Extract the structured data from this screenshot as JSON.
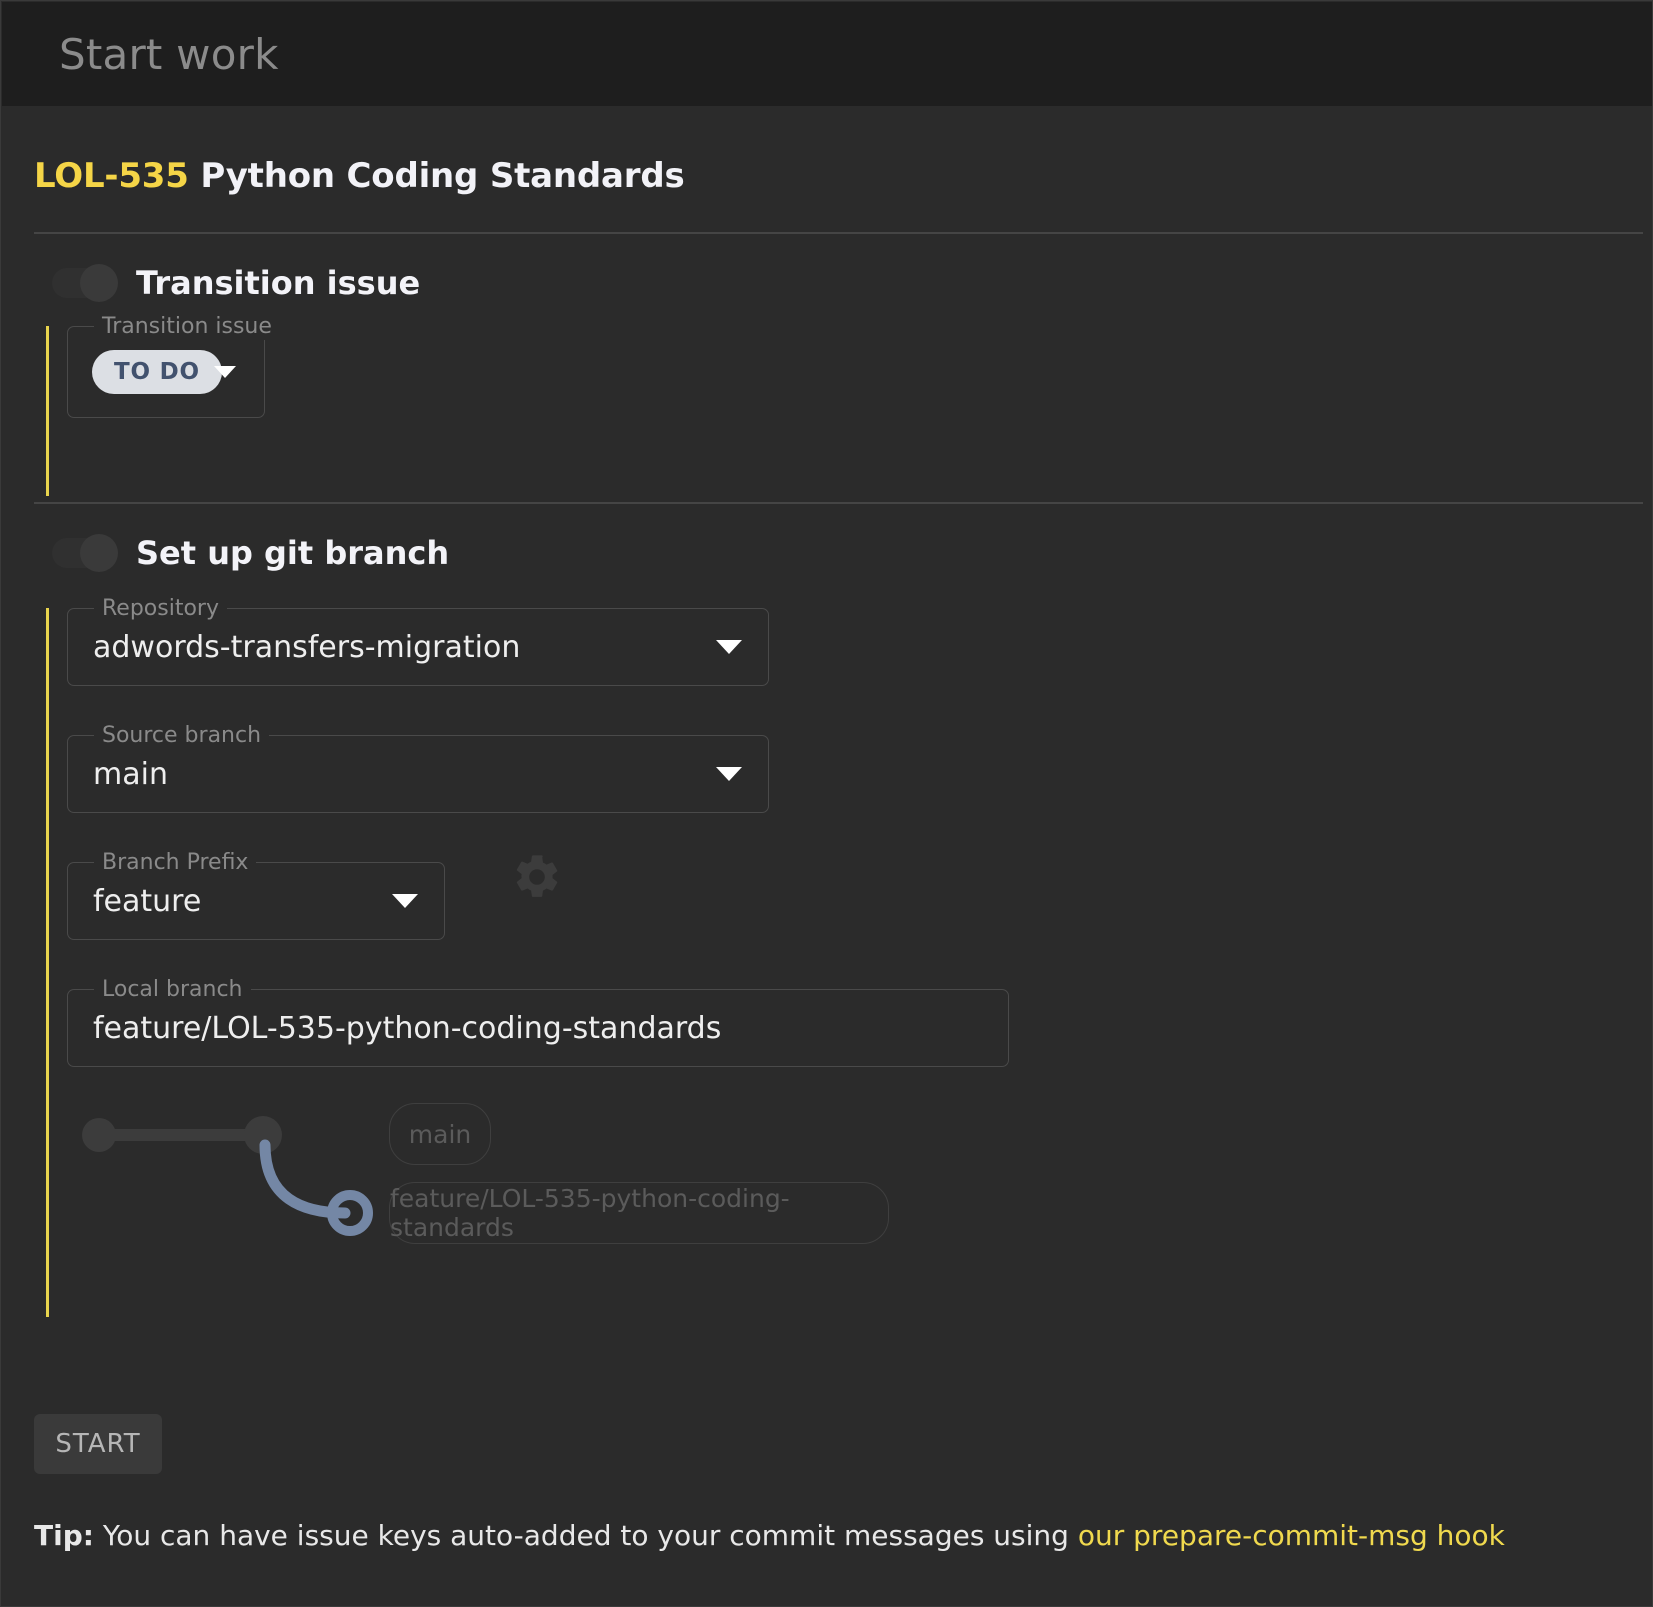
{
  "window": {
    "title": "Start work"
  },
  "issue": {
    "key": "LOL-535",
    "summary": "Python Coding Standards"
  },
  "transition_section": {
    "toggle_label": "Transition issue",
    "toggle_state": "on",
    "field": {
      "label": "Transition issue",
      "status_value": "TO DO"
    }
  },
  "git_section": {
    "toggle_label": "Set up git branch",
    "toggle_state": "on",
    "repository": {
      "label": "Repository",
      "value": "adwords-transfers-migration"
    },
    "source_branch": {
      "label": "Source branch",
      "value": "main"
    },
    "branch_prefix": {
      "label": "Branch Prefix",
      "value": "feature",
      "settings_icon": "gear-icon"
    },
    "local_branch": {
      "label": "Local branch",
      "value": "feature/LOL-535-python-coding-standards"
    },
    "graph": {
      "source_node_label": "main",
      "new_node_label": "feature/LOL-535-python-coding-standards"
    }
  },
  "footer": {
    "start_label": "START",
    "tip_prefix": "Tip:",
    "tip_text": "You can have issue keys auto-added to your commit messages using",
    "tip_link": "our prepare-commit-msg hook"
  },
  "colors": {
    "accent_yellow": "#e8d44d",
    "issue_key": "#f5d547",
    "link": "#f0d94e",
    "status_chip_bg": "#dcdfe4",
    "status_chip_text": "#42526e",
    "graph_branch_line": "#7487a5",
    "window_bg": "#2b2b2b",
    "titlebar_bg": "#1e1e1e"
  }
}
